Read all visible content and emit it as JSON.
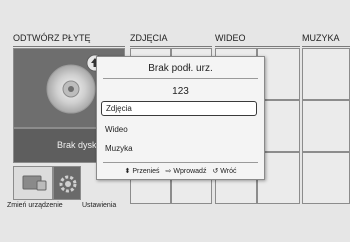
{
  "menu": {
    "tabs": [
      "ODTWÓRZ PŁYTĘ",
      "ZDJĘCIA",
      "WIDEO",
      "MUZYKA"
    ]
  },
  "disc_panel": {
    "label": "Brak dysku"
  },
  "shortcuts": {
    "change_device": "Zmień urządzenie",
    "settings": "Ustawienia"
  },
  "dialog": {
    "title": "Brak podł. urz.",
    "device_name": "123",
    "items": [
      "Zdjęcia",
      "Wideo",
      "Muzyka"
    ],
    "selected_index": 0,
    "footer": {
      "move": "Przenieś",
      "enter": "Wprowadź",
      "back": "Wróć"
    }
  },
  "icons": {
    "move": "up-down-arrows-icon",
    "enter": "enter-icon",
    "back": "back-arrow-icon",
    "disc": "disc-icon",
    "upload": "upload-arrow-icon",
    "device": "device-icon",
    "settings": "gear-icon"
  }
}
